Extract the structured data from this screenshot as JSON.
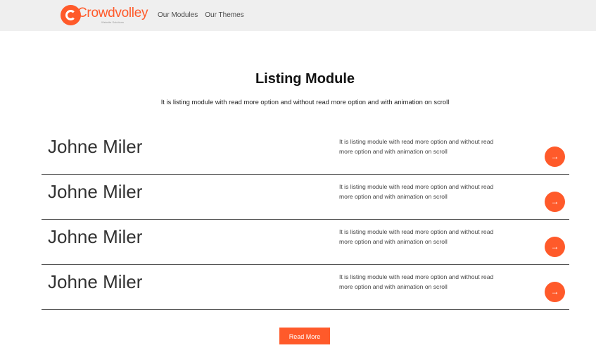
{
  "header": {
    "logo_text": "Crowdvolley",
    "logo_tagline": "Website Solutions",
    "nav": [
      "Our Modules",
      "Our Themes"
    ]
  },
  "main": {
    "title": "Listing Module",
    "subtitle": "It is listing module with read more option and without read more option and with animation on scroll",
    "items": [
      {
        "name": "Johne Miler",
        "description": "It is listing module with read more option and without read more option and with animation on scroll",
        "button_icon": "arrow-right-icon"
      },
      {
        "name": "Johne Miler",
        "description": "It is listing module with read more option and without read more option and with animation on scroll",
        "button_icon": "arrow-right-icon"
      },
      {
        "name": "Johne Miler",
        "description": "It is listing module with read more option and without read more option and with animation on scroll",
        "button_icon": "arrow-right-icon"
      },
      {
        "name": "Johne Miler",
        "description": "It is listing module with read more option and without read more option and with animation on scroll",
        "button_icon": "arrow-right-icon"
      }
    ],
    "read_more_label": "Read More"
  },
  "colors": {
    "accent": "#ff5a2a",
    "header_bg": "#efefef",
    "divider": "#555555"
  }
}
